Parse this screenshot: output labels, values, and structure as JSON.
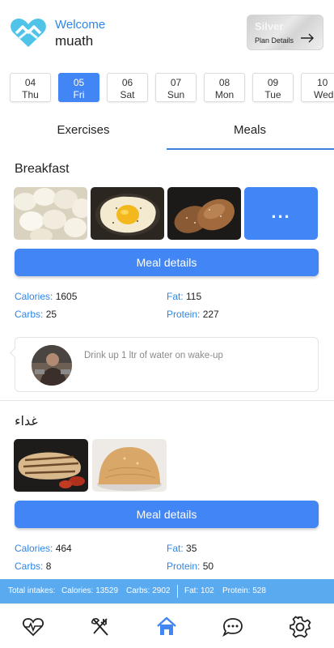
{
  "header": {
    "welcome": "Welcome",
    "username": "muath",
    "plan": {
      "tier": "Silver",
      "details_label": "Plan Details"
    }
  },
  "dates": [
    {
      "num": "04",
      "day": "Thu",
      "active": false
    },
    {
      "num": "05",
      "day": "Fri",
      "active": true
    },
    {
      "num": "06",
      "day": "Sat",
      "active": false
    },
    {
      "num": "07",
      "day": "Sun",
      "active": false
    },
    {
      "num": "08",
      "day": "Mon",
      "active": false
    },
    {
      "num": "09",
      "day": "Tue",
      "active": false
    },
    {
      "num": "10",
      "day": "Wed",
      "active": false
    }
  ],
  "tabs": {
    "exercises": "Exercises",
    "meals": "Meals",
    "selected": "Meals"
  },
  "meals": [
    {
      "title": "Breakfast",
      "more_label": "...",
      "button": "Meal details",
      "calories_label": "Calories:",
      "calories": "1605",
      "fat_label": "Fat:",
      "fat": "115",
      "carbs_label": "Carbs:",
      "carbs": "25",
      "protein_label": "Protein:",
      "protein": "227",
      "note": "Drink up 1 ltr of water on wake-up"
    },
    {
      "title": "غداء",
      "button": "Meal details",
      "calories_label": "Calories:",
      "calories": "464",
      "fat_label": "Fat:",
      "fat": "35",
      "carbs_label": "Carbs:",
      "carbs": "8",
      "protein_label": "Protein:",
      "protein": "50"
    }
  ],
  "totals": {
    "label": "Total intakes:",
    "calories_text": "Calories: 13529",
    "carbs_text": "Carbs: 2902",
    "fat_text": "Fat: 102",
    "protein_text": "Protein: 528"
  },
  "nav": {
    "items": [
      "heartbeat-icon",
      "utensils-icon",
      "home-icon",
      "chat-icon",
      "gear-icon"
    ],
    "active": "home-icon"
  },
  "colors": {
    "accent": "#4285f4",
    "label_blue": "#2d86e8",
    "totals_bar": "#5aaaf0",
    "text": "#222222"
  }
}
